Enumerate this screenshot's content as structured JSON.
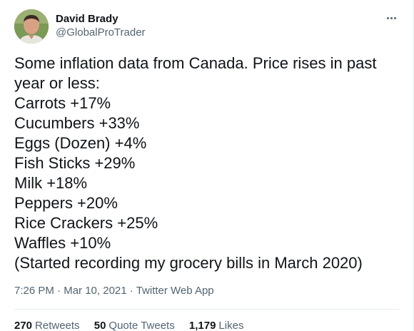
{
  "tweet": {
    "author": {
      "display_name": "David Brady",
      "handle": "@GlobalProTrader",
      "avatar_icon": "profile-photo"
    },
    "more_icon": "more-options-icon",
    "text": "Some inflation data from Canada. Price rises in past\nyear or less:\nCarrots +17%\nCucumbers +33%\nEggs (Dozen) +4%\nFish Sticks +29%\nMilk +18%\nPeppers +20%\nRice Crackers +25%\nWaffles +10%\n(Started recording my grocery bills in March 2020)",
    "time": "7:26 PM",
    "separator": "·",
    "date": "Mar 10, 2021",
    "source": "Twitter Web App",
    "stats": {
      "retweets_count": "270",
      "retweets_label": "Retweets",
      "quote_tweets_count": "50",
      "quote_tweets_label": "Quote Tweets",
      "likes_count": "1,179",
      "likes_label": "Likes"
    }
  },
  "colors": {
    "text_primary": "#0f1419",
    "text_secondary": "#536471",
    "divider": "#e6ecf0"
  }
}
